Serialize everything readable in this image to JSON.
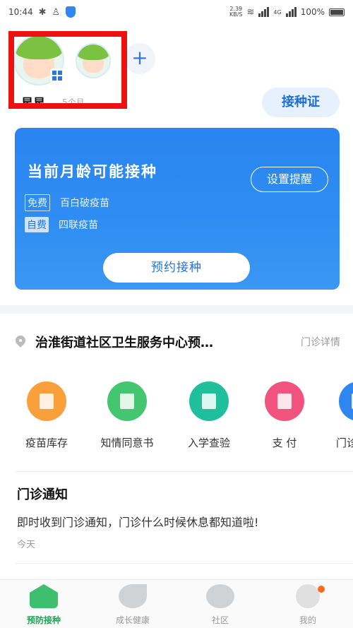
{
  "status_bar": {
    "time": "10:44",
    "net_speed": "2.39",
    "net_unit": "KB/S",
    "battery": "100%",
    "signal_label": "4G"
  },
  "profiles": {
    "baby_name": "星星",
    "baby_age": "5个月",
    "add_label": "+"
  },
  "header": {
    "certificate_label": "接种证"
  },
  "vaccine_card": {
    "title": "当前月龄可能接种",
    "remind_label": "设置提醒",
    "vaccines": [
      {
        "tag": "免费",
        "name": "百白破疫苗"
      },
      {
        "tag": "自费",
        "name": "四联疫苗"
      }
    ],
    "book_label": "预约接种"
  },
  "clinic": {
    "name": "治淮街道社区卫生服务中心预…",
    "detail_label": "门诊详情"
  },
  "features": [
    {
      "label": "疫苗库存",
      "color": "#f9a03a"
    },
    {
      "label": "知情同意书",
      "color": "#43c66f"
    },
    {
      "label": "入学查验",
      "color": "#1fbf9c"
    },
    {
      "label": "支 付",
      "color": "#f2527e"
    },
    {
      "label": "门诊",
      "color": "#2f86f0"
    }
  ],
  "notice": {
    "title": "门诊通知",
    "body": "即时收到门诊通知，门诊什么时候休息都知道啦!",
    "date": "今天"
  },
  "bottom_nav": [
    {
      "label": "预防接种",
      "icon": "house-icon",
      "active": true
    },
    {
      "label": "成长健康",
      "icon": "leaf-icon",
      "active": false
    },
    {
      "label": "社区",
      "icon": "planet-icon",
      "active": false
    },
    {
      "label": "我的",
      "icon": "profile-icon",
      "active": false
    }
  ],
  "colors": {
    "primary_blue": "#2a84f0",
    "active_green": "#2c9e5a",
    "highlight_red": "#ee1111"
  }
}
